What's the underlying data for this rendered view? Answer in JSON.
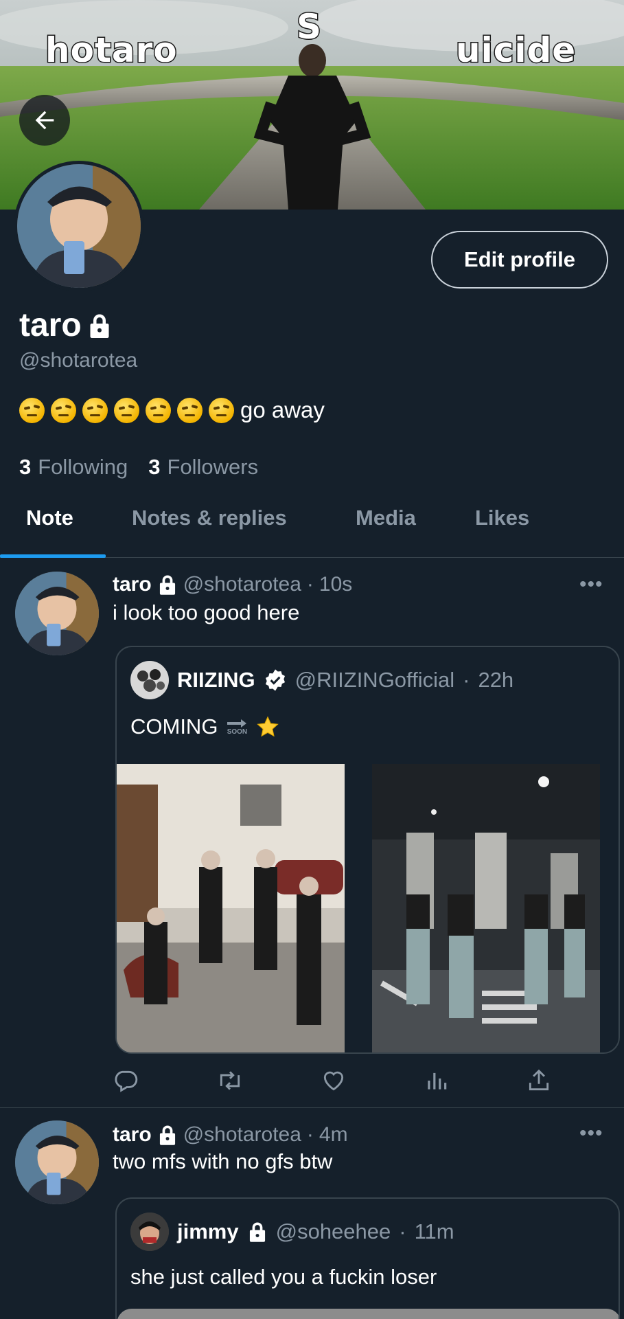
{
  "banner": {
    "overlay_left": "hotaro",
    "overlay_center": "S",
    "overlay_right": "uicide"
  },
  "profile": {
    "display_name": "taro",
    "handle": "@shotarotea",
    "bio_emoji_count": 7,
    "bio_emoji": "raised-eyebrow-face",
    "bio_text": "go away",
    "following_count": "3",
    "following_label": "Following",
    "followers_count": "3",
    "followers_label": "Followers",
    "edit_button": "Edit profile"
  },
  "tabs": [
    {
      "label": "Note",
      "active": true
    },
    {
      "label": "Notes & replies",
      "active": false
    },
    {
      "label": "Media",
      "active": false
    },
    {
      "label": "Likes",
      "active": false
    }
  ],
  "posts": [
    {
      "author_name": "taro",
      "author_handle": "@shotarotea",
      "time": "10s",
      "text": "i look too good here",
      "quote": {
        "author_name": "RIIZING",
        "author_handle": "@RIIZINGofficial",
        "time": "22h",
        "verified": true,
        "text": "COMING",
        "soon_emoji": "SOON",
        "star_emoji": "star"
      },
      "actions": [
        "reply-icon",
        "retweet-icon",
        "like-icon",
        "views-icon",
        "share-icon"
      ]
    },
    {
      "author_name": "taro",
      "author_handle": "@shotarotea",
      "time": "4m",
      "text": "two mfs with no gfs btw",
      "quote": {
        "author_name": "jimmy",
        "author_handle": "@soheehee",
        "time": "11m",
        "verified": false,
        "text": "she just called you a fuckin loser"
      }
    }
  ],
  "colors": {
    "background": "#15202b",
    "accent": "#1d9bf0",
    "secondary_text": "#8b98a5",
    "border": "#38444d"
  }
}
